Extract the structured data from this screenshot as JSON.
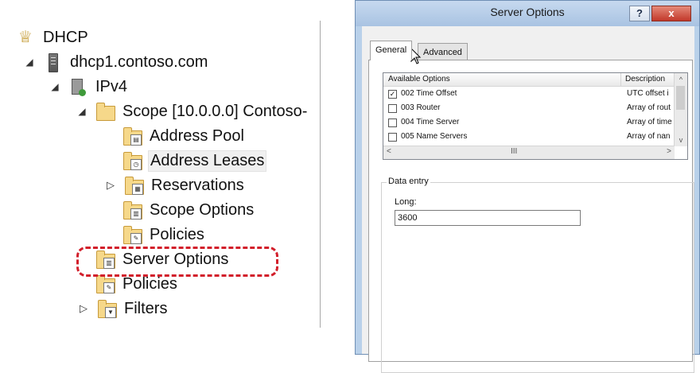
{
  "tree": {
    "nodes": [
      {
        "label": "DHCP",
        "icon": "dhcp-icon",
        "expander": ""
      },
      {
        "label": "dhcp1.contoso.com",
        "icon": "server-icon",
        "expander": "◢"
      },
      {
        "label": "IPv4",
        "icon": "ipv4-icon",
        "expander": "◢"
      },
      {
        "label": "Scope [10.0.0.0] Contoso-",
        "icon": "folder-icon",
        "expander": "◢"
      },
      {
        "label": "Address Pool",
        "icon": "address-pool-icon",
        "expander": ""
      },
      {
        "label": "Address Leases",
        "icon": "address-leases-icon",
        "expander": ""
      },
      {
        "label": "Reservations",
        "icon": "reservations-icon",
        "expander": "▷"
      },
      {
        "label": "Scope Options",
        "icon": "scope-options-icon",
        "expander": ""
      },
      {
        "label": "Policies",
        "icon": "policies-icon",
        "expander": ""
      },
      {
        "label": "Server Options",
        "icon": "server-options-icon",
        "expander": ""
      },
      {
        "label": "Policies",
        "icon": "policies-icon",
        "expander": ""
      },
      {
        "label": "Filters",
        "icon": "filters-icon",
        "expander": "▷"
      }
    ],
    "highlight_color": "#d21f2b"
  },
  "dialog": {
    "title": "Server Options",
    "help_label": "?",
    "close_label": "x",
    "tabs": [
      {
        "label": "General",
        "active": true
      },
      {
        "label": "Advanced",
        "active": false
      }
    ],
    "options_list": {
      "headers": {
        "name": "Available Options",
        "description": "Description"
      },
      "rows": [
        {
          "name": "002 Time Offset",
          "description": "UTC offset i",
          "checked": true
        },
        {
          "name": "003 Router",
          "description": "Array of rout",
          "checked": false
        },
        {
          "name": "004 Time Server",
          "description": "Array of time",
          "checked": false
        },
        {
          "name": "005 Name Servers",
          "description": "Array of nan",
          "checked": false
        }
      ],
      "scroll_left": "<",
      "scroll_right": ">",
      "scroll_thumb": "III",
      "scroll_up": "^",
      "scroll_down": "v"
    },
    "data_entry": {
      "legend": "Data entry",
      "long_label": "Long:",
      "long_value": "3600"
    }
  }
}
